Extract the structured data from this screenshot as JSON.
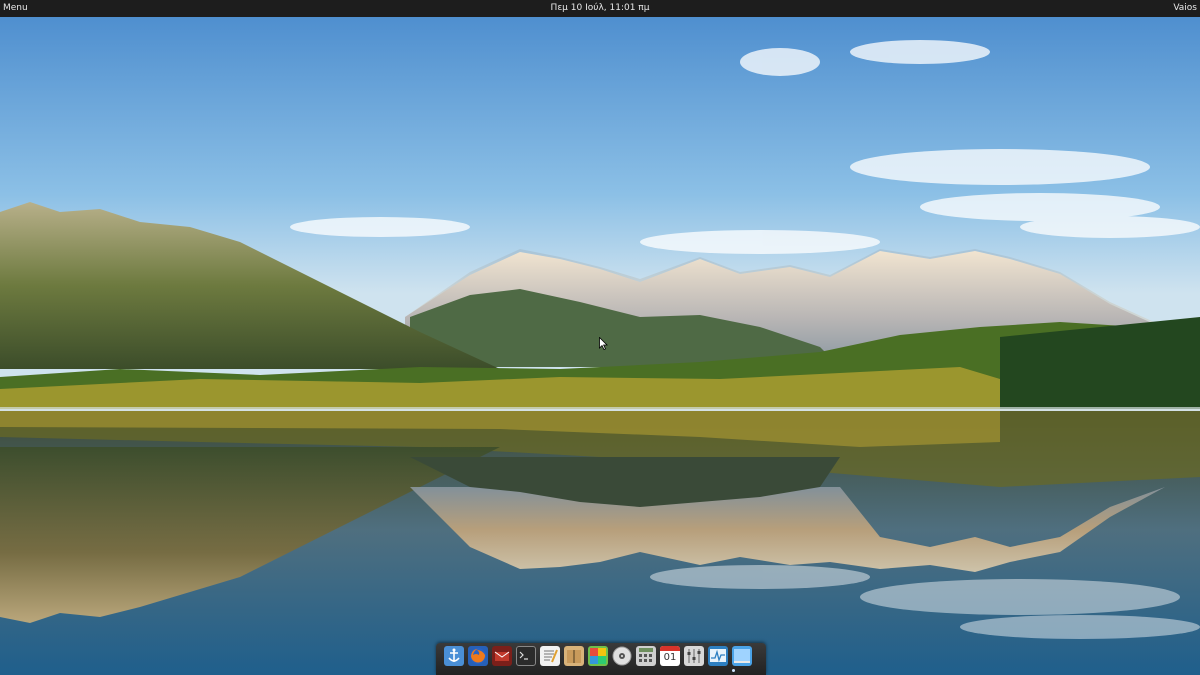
{
  "panel": {
    "menu_label": "Menu",
    "datetime": "Πεμ 10 Ιούλ, 11:01 πμ",
    "user_label": "Vaios"
  },
  "desktop": {
    "wallpaper": "lake-mountains-reflection"
  },
  "dock": {
    "apps": [
      {
        "name": "anchor-app-icon",
        "color": "#4a8fd6"
      },
      {
        "name": "firefox-icon",
        "color": "#e8761f"
      },
      {
        "name": "mail-app-icon",
        "color": "#c0392b"
      },
      {
        "name": "terminal-icon",
        "color": "#2b2b2b"
      },
      {
        "name": "text-editor-icon",
        "color": "#f2f2f2"
      },
      {
        "name": "archive-icon",
        "color": "#d9b37a"
      },
      {
        "name": "photos-icon",
        "color": "#6fbf4c"
      },
      {
        "name": "disc-icon",
        "color": "#dddddd"
      },
      {
        "name": "calculator-icon",
        "color": "#cccccc"
      },
      {
        "name": "calendar-icon",
        "color": "#ffffff"
      },
      {
        "name": "settings-icon",
        "color": "#d8d8d8"
      },
      {
        "name": "system-monitor-icon",
        "color": "#2d7fc1"
      },
      {
        "name": "desktop-icon",
        "color": "#4aa3e8"
      }
    ],
    "calendar_day": "01"
  }
}
